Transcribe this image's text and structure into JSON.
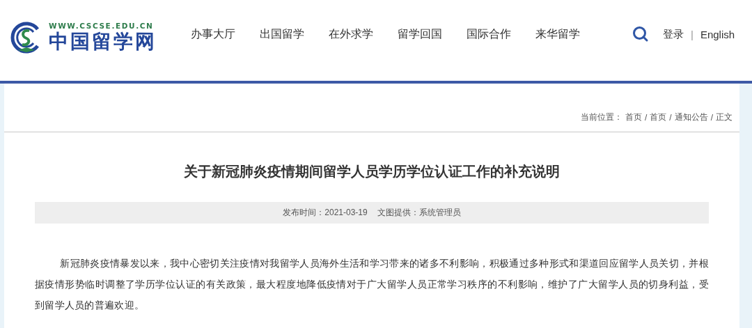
{
  "logo": {
    "url": "WWW.CSCSE.EDU.CN",
    "name": "中国留学网"
  },
  "nav": [
    {
      "label": "办事大厅"
    },
    {
      "label": "出国留学"
    },
    {
      "label": "在外求学"
    },
    {
      "label": "留学回国"
    },
    {
      "label": "国际合作"
    },
    {
      "label": "来华留学"
    }
  ],
  "account": {
    "login": "登录",
    "separator": "|",
    "language": "English"
  },
  "breadcrumb": {
    "label": "当前位置：",
    "separator": "/",
    "items": [
      "首页",
      "首页",
      "通知公告",
      "正文"
    ]
  },
  "article": {
    "title": "关于新冠肺炎疫情期间留学人员学历学位认证工作的补充说明",
    "meta": [
      "发布时间：2021-03-19",
      "文图提供：系统管理员"
    ],
    "paragraphs": [
      "新冠肺炎疫情暴发以来，我中心密切关注疫情对我留学人员海外生活和学习带来的诸多不利影响，积极通过多种形式和渠道回应留学人员关切，并根据疫情形势临时调整了学历学位认证的有关政策，最大程度地降低疫情对于广大留学人员正常学习秩序的不利影响，维护了广大留学人员的切身利益，受到留学人员的普遍欢迎。"
    ]
  }
}
